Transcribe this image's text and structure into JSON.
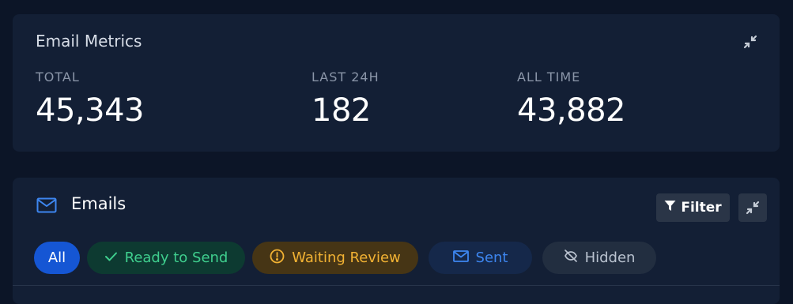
{
  "metrics": {
    "title": "Email Metrics",
    "items": [
      {
        "label": "TOTAL",
        "value": "45,343"
      },
      {
        "label": "LAST 24H",
        "value": "182"
      },
      {
        "label": "ALL TIME",
        "value": "43,882"
      }
    ],
    "expand_icon": "collapse-arrows-icon"
  },
  "emails": {
    "title": "Emails",
    "header_icon": "mail-icon",
    "filter_label": "Filter",
    "filter_icon": "funnel-icon",
    "expand_icon": "collapse-arrows-icon",
    "tabs": [
      {
        "label": "All",
        "color": "#1556d4"
      },
      {
        "label": "Ready to Send",
        "icon": "check-icon",
        "color": "#3fcf8e"
      },
      {
        "label": "Waiting Review",
        "icon": "alert-circle-icon",
        "color": "#f2b233"
      },
      {
        "label": "Sent",
        "icon": "mail-icon",
        "color": "#3d86f0"
      },
      {
        "label": "Hidden",
        "icon": "eye-off-icon",
        "color": "#b9c2cf"
      }
    ]
  }
}
